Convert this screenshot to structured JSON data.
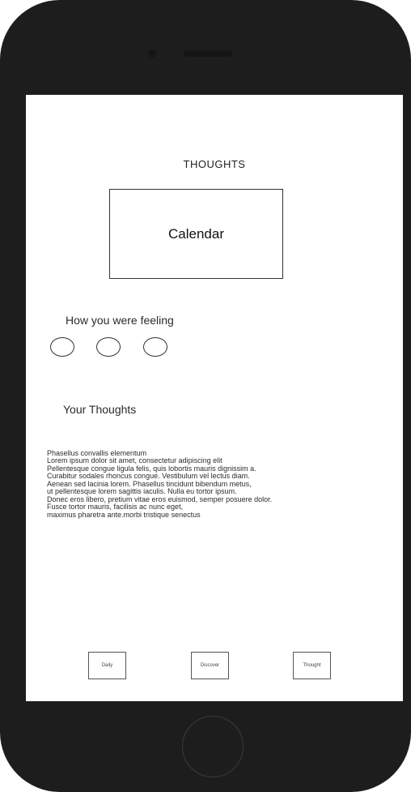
{
  "screen": {
    "title": "THOUGHTS",
    "calendar_label": "Calendar",
    "feeling_label": "How you were feeling",
    "mood_options": [
      "mood-1",
      "mood-2",
      "mood-3"
    ],
    "thoughts_label": "Your Thoughts",
    "thoughts_lines": [
      "Phasellus convallis elementum",
      "Lorem ipsum dolor sit amet, consectetur adipiscing elit",
      "Pellentesque congue ligula felis, quis lobortis mauris dignissim a.",
      "Curabitur sodales rhoncus congue. Vestibulum vel lectus diam.",
      "Aenean sed lacinia lorem. Phasellus tincidunt bibendum metus,",
      "ut pellentesque lorem sagittis iaculis. Nulla eu tortor ipsum.",
      "Donec eros libero, pretium vitae eros euismod, semper posuere dolor.",
      "Fusce tortor mauris, facilisis ac nunc eget,",
      "maximus pharetra ante.morbi tristique senectus"
    ],
    "tabs": [
      {
        "label": "Daily"
      },
      {
        "label": "Discover"
      },
      {
        "label": "Thought"
      }
    ]
  }
}
